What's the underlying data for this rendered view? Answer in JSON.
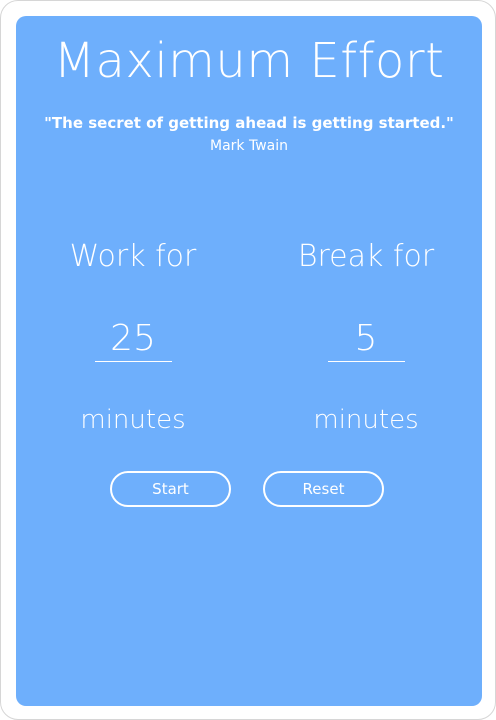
{
  "app": {
    "title": "Maximum Effort",
    "quote": "\"The secret of getting ahead is getting started.\"",
    "author": "Mark Twain"
  },
  "work": {
    "label": "Work for",
    "value": "25",
    "unit": "minutes"
  },
  "break": {
    "label": "Break for",
    "value": "5",
    "unit": "minutes"
  },
  "buttons": {
    "start": "Start",
    "reset": "Reset"
  },
  "colors": {
    "card_background": "#6eaffc",
    "text": "#ffffff"
  }
}
